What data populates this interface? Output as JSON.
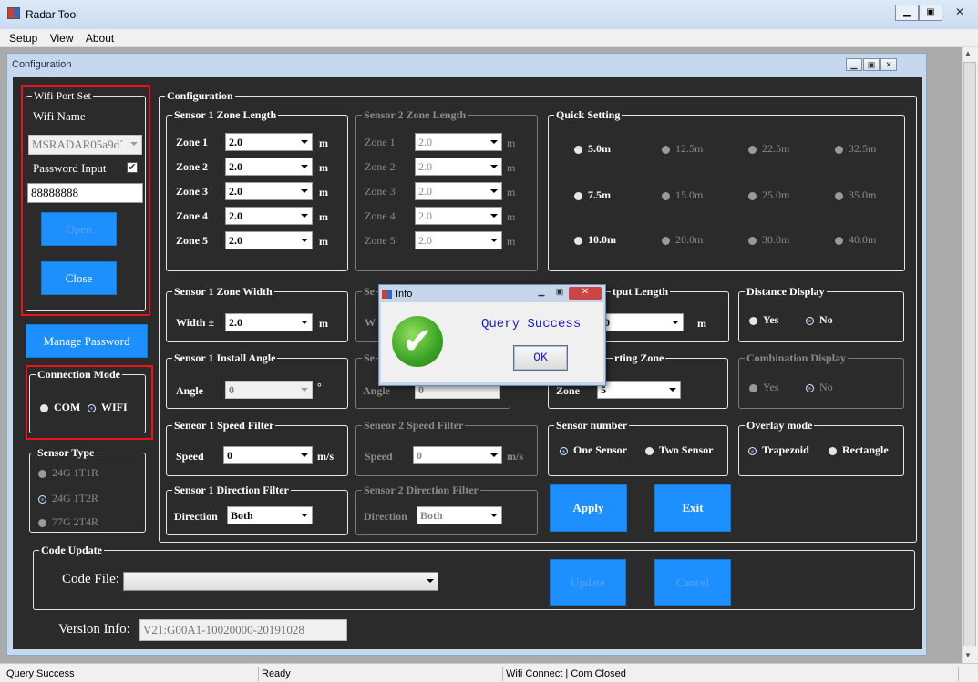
{
  "window": {
    "title": "Radar Tool"
  },
  "menu": [
    "Setup",
    "View",
    "About"
  ],
  "child": {
    "title": "Configuration"
  },
  "wifi": {
    "legend": "Wifi Port Set",
    "name_label": "Wifi Name",
    "name_value": "MSRADAR05a9d´",
    "password_label": "Password Input",
    "password_checked": true,
    "password_value": "88888888",
    "open_label": "Open",
    "close_label": "Close"
  },
  "manage_password": "Manage Password",
  "connection": {
    "legend": "Connection Mode",
    "com": "COM",
    "wifi": "WIFI",
    "selected": "WIFI"
  },
  "sensor_type": {
    "legend": "Sensor Type",
    "options": [
      "24G 1T1R",
      "24G 1T2R",
      "77G 2T4R"
    ],
    "selected": "24G 1T2R"
  },
  "config": {
    "legend": "Configuration"
  },
  "s1_zone_length": {
    "legend": "Sensor 1 Zone Length",
    "rows": [
      {
        "label": "Zone 1",
        "value": "2.0",
        "unit": "m"
      },
      {
        "label": "Zone 2",
        "value": "2.0",
        "unit": "m"
      },
      {
        "label": "Zone 3",
        "value": "2.0",
        "unit": "m"
      },
      {
        "label": "Zone 4",
        "value": "2.0",
        "unit": "m"
      },
      {
        "label": "Zone 5",
        "value": "2.0",
        "unit": "m"
      }
    ]
  },
  "s2_zone_length": {
    "legend": "Sensor 2 Zone Length",
    "rows": [
      {
        "label": "Zone 1",
        "value": "2.0",
        "unit": "m"
      },
      {
        "label": "Zone 2",
        "value": "2.0",
        "unit": "m"
      },
      {
        "label": "Zone 3",
        "value": "2.0",
        "unit": "m"
      },
      {
        "label": "Zone 4",
        "value": "2.0",
        "unit": "m"
      },
      {
        "label": "Zone 5",
        "value": "2.0",
        "unit": "m"
      }
    ]
  },
  "quick_setting": {
    "legend": "Quick Setting",
    "options": [
      "5.0m",
      "12.5m",
      "22.5m",
      "32.5m",
      "7.5m",
      "15.0m",
      "25.0m",
      "35.0m",
      "10.0m",
      "20.0m",
      "30.0m",
      "40.0m"
    ]
  },
  "s1_zone_width": {
    "legend": "Sensor 1 Zone Width",
    "label": "Width ±",
    "value": "2.0",
    "unit": "m"
  },
  "s2_zone_width": {
    "legend_frag": "Se",
    "label_frag": "W"
  },
  "output_length": {
    "legend_frag": "tput Length",
    "value": "0",
    "unit": "m"
  },
  "distance_display": {
    "legend": "Distance Display",
    "yes": "Yes",
    "no": "No",
    "selected": "No"
  },
  "s1_install_angle": {
    "legend": "Sensor 1 Install Angle",
    "label": "Angle",
    "value": "0",
    "unit": "°"
  },
  "s2_install_angle": {
    "legend_frag": "Se",
    "label_frag": "Angle",
    "value": "0"
  },
  "starting_zone": {
    "legend_frag": "rting Zone",
    "label_frag": "Zone",
    "value": "5"
  },
  "combination_display": {
    "legend": "Combination Display",
    "yes": "Yes",
    "no": "No",
    "selected": "No"
  },
  "s1_speed_filter": {
    "legend": "Seneor 1 Speed Filter",
    "label": "Speed",
    "value": "0",
    "unit": "m/s"
  },
  "s2_speed_filter": {
    "legend": "Seneor 2 Speed Filter",
    "label": "Speed",
    "value": "0",
    "unit": "m/s"
  },
  "sensor_number": {
    "legend": "Sensor number",
    "one": "One Sensor",
    "two": "Two Sensor",
    "selected": "One Sensor"
  },
  "overlay_mode": {
    "legend": "Overlay mode",
    "trapezoid": "Trapezoid",
    "rectangle": "Rectangle",
    "selected": "Trapezoid"
  },
  "s1_direction_filter": {
    "legend": "Sensor 1 Direction Filter",
    "label": "Direction",
    "value": "Both"
  },
  "s2_direction_filter": {
    "legend": "Sensor 2 Direction Filter",
    "label": "Direction",
    "value": "Both"
  },
  "apply_label": "Apply",
  "exit_label": "Exit",
  "code_update": {
    "legend": "Code Update",
    "file_label": "Code File:",
    "file_value": "",
    "update_label": "Update",
    "cancel_label": "Cancel"
  },
  "version": {
    "label": "Version Info:",
    "value": "V21:G00A1-10020000-20191028"
  },
  "dialog": {
    "title": "Info",
    "message": "Query Success",
    "ok": "OK"
  },
  "status": {
    "left": "Query Success",
    "middle": "Ready",
    "right": "Wifi Connect | Com Closed"
  },
  "colors": {
    "background": "#2b2b2b",
    "button": "#1e8fff",
    "highlight": "#e8141b",
    "text": "#ffffff"
  }
}
